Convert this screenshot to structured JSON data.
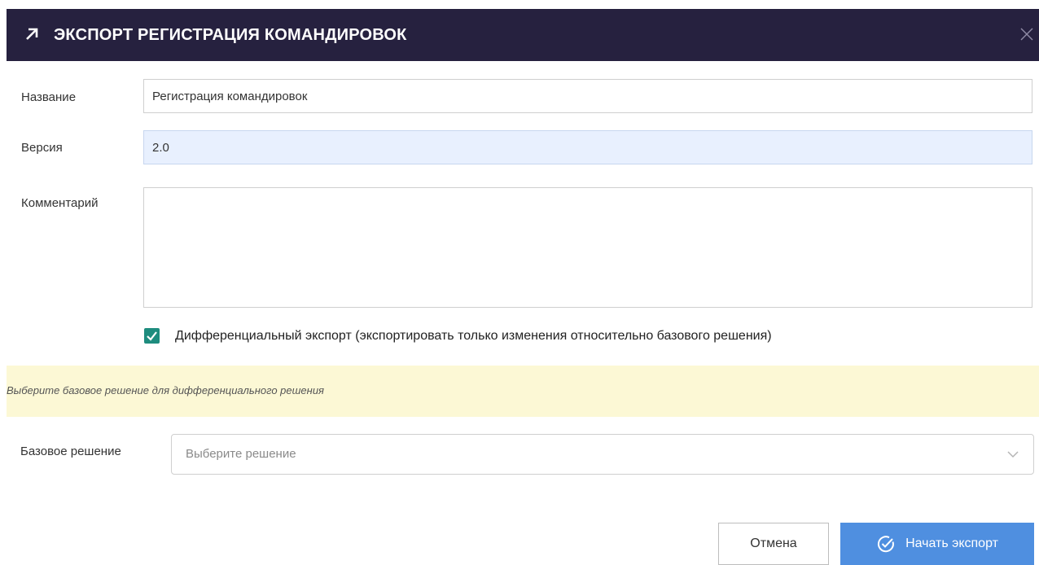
{
  "dialog": {
    "title": "ЭКСПОРТ РЕГИСТРАЦИЯ КОМАНДИРОВОК",
    "header_color": "#26213f",
    "icons": {
      "title": "arrow-up-right-icon",
      "close": "close-icon"
    }
  },
  "form": {
    "name": {
      "label": "Название",
      "value": "Регистрация командировок"
    },
    "version": {
      "label": "Версия",
      "value": "2.0"
    },
    "comment": {
      "label": "Комментарий",
      "value": ""
    },
    "differential": {
      "checked": true,
      "label": "Дифференциальный экспорт (экспортировать только изменения относительно базового решения)",
      "color": "#1e8c7e"
    },
    "notice": {
      "text": "Выберите базовое решение для дифференциального решения",
      "color": "#fcf8d5"
    },
    "base_solution": {
      "label": "Базовое решение",
      "placeholder": "Выберите решение"
    }
  },
  "footer": {
    "cancel_label": "Отмена",
    "start_label": "Начать экспорт",
    "primary_color": "#4f8fe0",
    "start_icon": "check-circle-icon"
  }
}
